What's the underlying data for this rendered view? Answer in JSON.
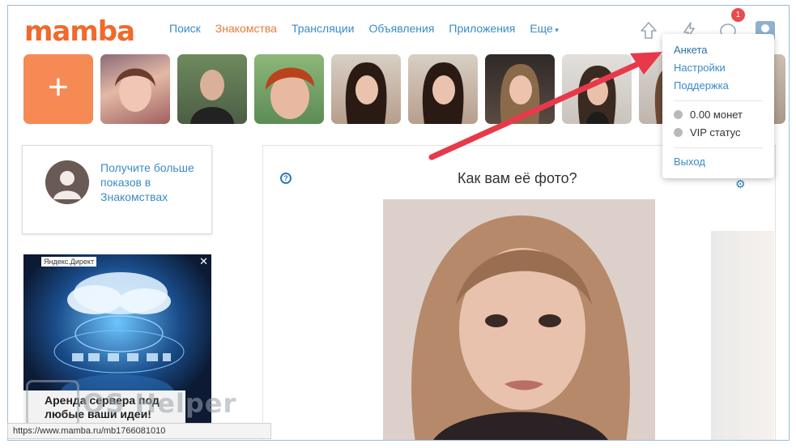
{
  "logo": "mamba",
  "nav": {
    "items": [
      "Поиск",
      "Знакомства",
      "Трансляции",
      "Объявления",
      "Приложения",
      "Еще"
    ],
    "active_index": 1
  },
  "header": {
    "notification_count": "1"
  },
  "strip": {
    "add_label": "+"
  },
  "promo": {
    "text": "Получите больше показов в Знакомствах"
  },
  "ad": {
    "label": "Яндекс.Директ",
    "close": "✕",
    "caption": "Аренда сервера под любые ваши идеи!"
  },
  "card": {
    "title": "Как вам её фото?",
    "help": "?"
  },
  "dropdown": {
    "items": [
      "Анкета",
      "Настройки",
      "Поддержка"
    ],
    "coins": "0.00 монет",
    "vip": "VIP статус",
    "logout": "Выход"
  },
  "watermark": "OS Helper",
  "status_url": "https://www.mamba.ru/mb1766081010",
  "colors": {
    "brand": "#ef6a2c",
    "link": "#3a8bc7",
    "arrow": "#e8394a",
    "add_tile": "#f58a55"
  }
}
